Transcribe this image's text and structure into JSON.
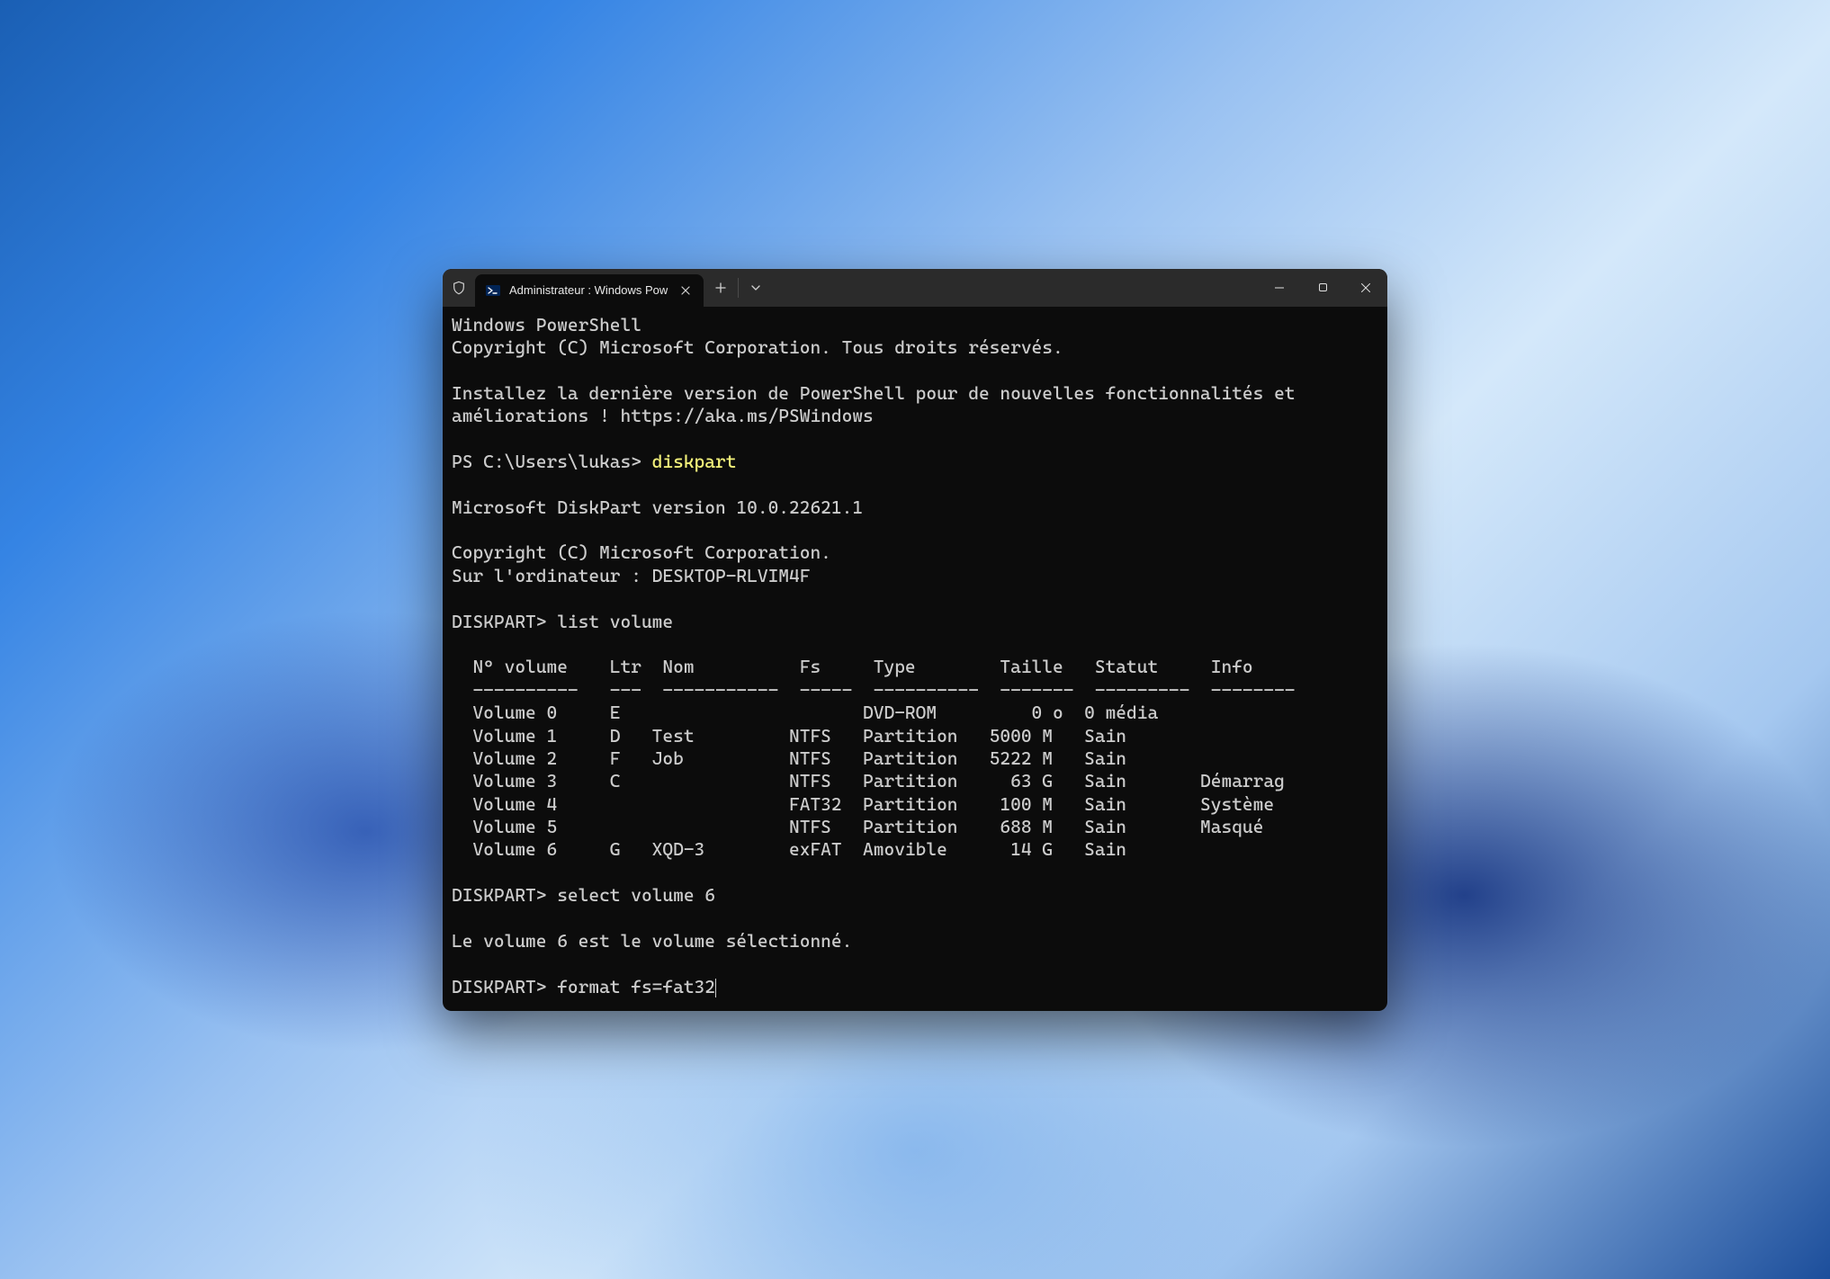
{
  "titlebar": {
    "tab_title": "Administrateur : Windows Pow",
    "icons": {
      "shield": "shield-icon",
      "powershell": "powershell-icon",
      "close_tab": "×",
      "new_tab": "+",
      "dropdown": "⌄"
    }
  },
  "terminal": {
    "banner_line1": "Windows PowerShell",
    "banner_line2": "Copyright (C) Microsoft Corporation. Tous droits réservés.",
    "hint_line1": "Installez la dernière version de PowerShell pour de nouvelles fonctionnalités et",
    "hint_line2": "améliorations ! https://aka.ms/PSWindows",
    "ps_prompt": "PS C:\\Users\\lukas> ",
    "ps_command": "diskpart",
    "dp_version": "Microsoft DiskPart version 10.0.22621.1",
    "dp_copyright": "Copyright (C) Microsoft Corporation.",
    "dp_computer": "Sur l'ordinateur : DESKTOP-RLVIM4F",
    "dp_prompt1": "DISKPART> ",
    "dp_cmd1": "list volume",
    "table": {
      "header": "  N° volume    Ltr  Nom          Fs     Type        Taille   Statut     Info",
      "divider": "  ----------   ---  -----------  -----  ----------  -------  ---------  --------",
      "rows": [
        "  Volume 0     E                       DVD-ROM         0 o  0 média",
        "  Volume 1     D   Test         NTFS   Partition   5000 M   Sain",
        "  Volume 2     F   Job          NTFS   Partition   5222 M   Sain",
        "  Volume 3     C                NTFS   Partition     63 G   Sain       Démarrag",
        "  Volume 4                      FAT32  Partition    100 M   Sain       Système",
        "  Volume 5                      NTFS   Partition    688 M   Sain       Masqué",
        "  Volume 6     G   XQD-3        exFAT  Amovible      14 G   Sain"
      ]
    },
    "dp_prompt2": "DISKPART> ",
    "dp_cmd2": "select volume 6",
    "select_result": "Le volume 6 est le volume sélectionné.",
    "dp_prompt3": "DISKPART> ",
    "dp_cmd3": "format fs=fat32"
  }
}
